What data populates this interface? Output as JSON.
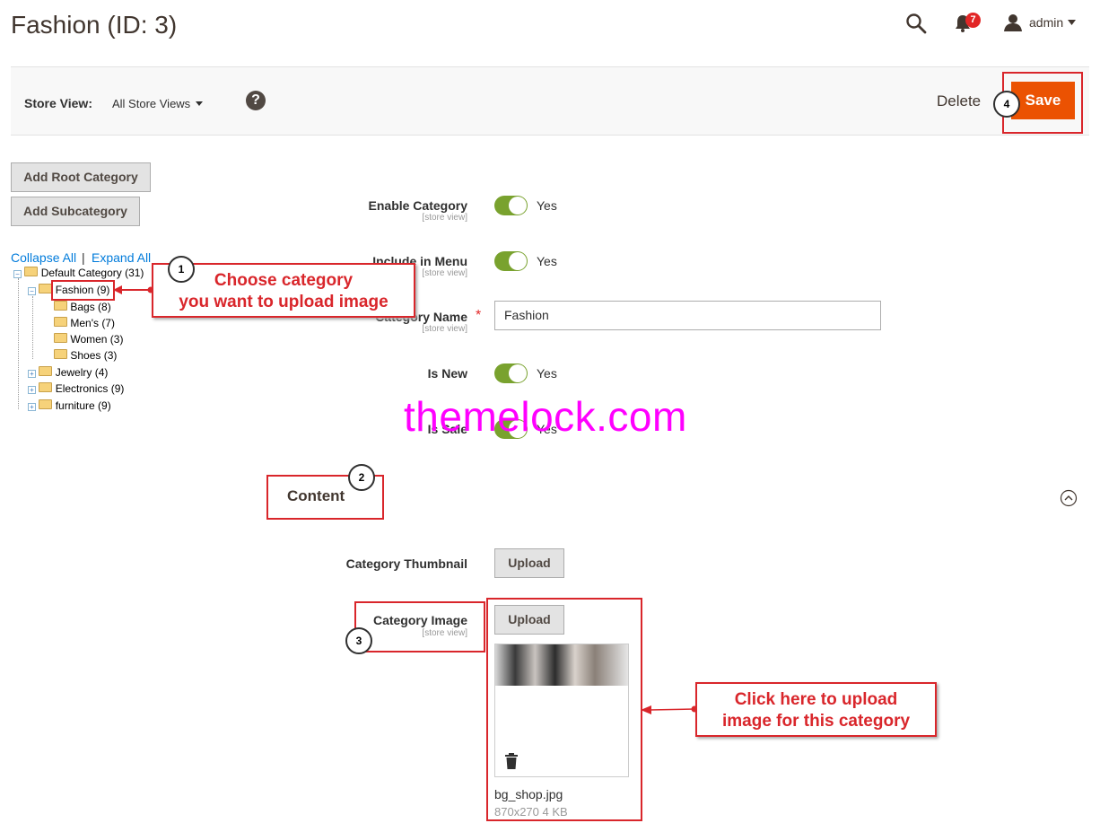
{
  "header": {
    "title": "Fashion (ID: 3)",
    "notifications_count": "7",
    "user": "admin"
  },
  "toolbar": {
    "store_view_label": "Store View:",
    "store_view_value": "All Store Views",
    "help": "?",
    "delete_label": "Delete",
    "save_label": "Save"
  },
  "tree_panel": {
    "add_root": "Add Root Category",
    "add_sub": "Add Subcategory",
    "collapse_all": "Collapse All",
    "separator": "|",
    "expand_all": "Expand All",
    "nodes": [
      {
        "label": "Default Category (31)"
      },
      {
        "label": "Fashion (9)"
      },
      {
        "label": "Bags (8)"
      },
      {
        "label": "Men's (7)"
      },
      {
        "label": "Women (3)"
      },
      {
        "label": "Shoes (3)"
      },
      {
        "label": "Jewelry (4)"
      },
      {
        "label": "Electronics (9)"
      },
      {
        "label": "furniture (9)"
      }
    ]
  },
  "form": {
    "scope_text": "[store view]",
    "enable_label": "Enable Category",
    "enable_value": "Yes",
    "menu_label": "Include in Menu",
    "menu_value": "Yes",
    "name_label": "Category Name",
    "name_value": "Fashion",
    "new_label": "Is New",
    "new_value": "Yes",
    "sale_label": "Is Sale",
    "sale_value": "Yes",
    "content_title": "Content",
    "thumb_label": "Category Thumbnail",
    "upload_label": "Upload",
    "image_label": "Category Image",
    "file_name": "bg_shop.jpg",
    "file_meta": "870x270 4 KB"
  },
  "annotations": {
    "step1": "1",
    "step2": "2",
    "step3": "3",
    "step4": "4",
    "callout1_line1": "Choose category",
    "callout1_line2": "you want to upload image",
    "callout2_line1": "Click here to upload",
    "callout2_line2": "image for this category",
    "watermark": "themelock.com"
  },
  "colors": {
    "accent": "#eb5202",
    "toggle_on": "#79a22e",
    "annotation": "#d9262b",
    "watermark": "#ff00ff",
    "link": "#007bdb"
  }
}
